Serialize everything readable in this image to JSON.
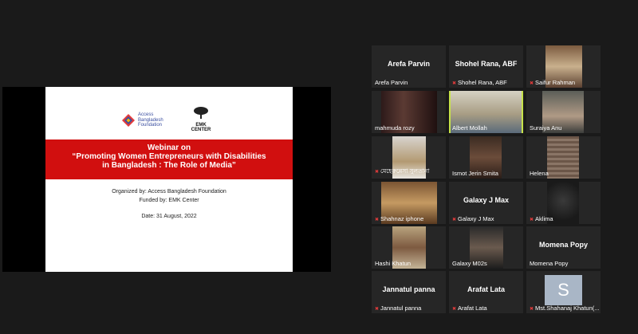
{
  "slide": {
    "abf_logo_text": "Access\nBangladesh\nFoundation",
    "emk_logo_text": "EMK\nCENTER",
    "title_line1": "Webinar on",
    "title_line2": "“Promoting Women Entrepreneurs with Disabilities",
    "title_line3": "in Bangladesh : The Role of Media”",
    "organized_by": "Organized by: Access Bangladesh Foundation",
    "funded_by": "Funded by: EMK Center",
    "date": "Date: 31 August, 2022",
    "band_color": "#d10f0f"
  },
  "participants": [
    {
      "name": "Arefa Parvin",
      "center_name": "Arefa Parvin",
      "muted": false
    },
    {
      "name": "Shohel Rana, ABF",
      "center_name": "Shohel Rana, ABF",
      "muted": true
    },
    {
      "name": "Saifur Rahman",
      "muted": true
    },
    {
      "name": "mahmuda rozy",
      "muted": false
    },
    {
      "name": "Albert Mollah",
      "muted": false,
      "active_speaker": true
    },
    {
      "name": "Suraiya Anu",
      "muted": false
    },
    {
      "name": "মেহেরুন্নেসা সুলতানা",
      "muted": true
    },
    {
      "name": "Ismot Jerin Smita",
      "muted": false
    },
    {
      "name": "Helena",
      "muted": false
    },
    {
      "name": "Shahnaz iphone",
      "muted": true
    },
    {
      "name": "Galaxy J Max",
      "center_name": "Galaxy J Max",
      "muted": true
    },
    {
      "name": "Aklima",
      "muted": true
    },
    {
      "name": "Hashi Khatun",
      "muted": false
    },
    {
      "name": "Galaxy M02s",
      "muted": false
    },
    {
      "name": "Momena Popy",
      "center_name": "Momena Popy",
      "muted": false
    },
    {
      "name": "Jannatul panna",
      "center_name": "Jannatul panna",
      "muted": true
    },
    {
      "name": "Arafat Lata",
      "center_name": "Arafat Lata",
      "muted": true
    },
    {
      "name": "Mst.Shahanaj Khatun(...",
      "avatar_letter": "S",
      "muted": true
    }
  ]
}
